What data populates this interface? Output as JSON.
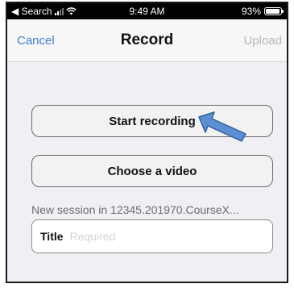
{
  "status_bar": {
    "back_label": "◀ Search",
    "time": "9:49 AM",
    "battery_percent": "93%",
    "battery_level": 0.93,
    "signal_bars": 2,
    "icons": [
      "cellular-signal-icon",
      "wifi-icon",
      "battery-icon"
    ]
  },
  "nav": {
    "cancel_label": "Cancel",
    "title": "Record",
    "upload_label": "Upload"
  },
  "actions": {
    "start_label": "Start recording",
    "choose_label": "Choose a video"
  },
  "annotation": {
    "icon": "pointer-arrow-icon",
    "color": "#5b8fd2"
  },
  "session": {
    "label": "New session in 12345.201970.CourseX...",
    "title_label": "Title",
    "title_placeholder": "Required",
    "title_value": ""
  },
  "colors": {
    "accent": "#3d7fce",
    "disabled": "#b8b8bd",
    "background": "#efeff4"
  }
}
